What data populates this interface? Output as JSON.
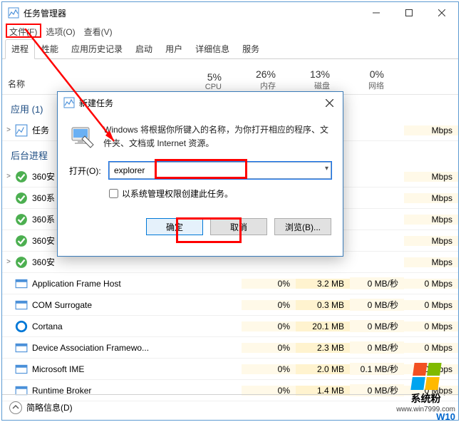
{
  "title": "任务管理器",
  "menus": {
    "file": "文件(F)",
    "options": "选项(O)",
    "view": "查看(V)"
  },
  "tabs": [
    "进程",
    "性能",
    "应用历史记录",
    "启动",
    "用户",
    "详细信息",
    "服务"
  ],
  "headers": {
    "name": "名称",
    "cpu": {
      "pct": "5%",
      "lbl": "CPU"
    },
    "mem": {
      "pct": "26%",
      "lbl": "内存"
    },
    "disk": {
      "pct": "13%",
      "lbl": "磁盘"
    },
    "net": {
      "pct": "0%",
      "lbl": "网络"
    }
  },
  "groups": {
    "apps": "应用 (1)",
    "bg": "后台进程"
  },
  "rows": [
    {
      "name": "任务",
      "cpu": "",
      "mem": "",
      "disk": "",
      "net": "Mbps",
      "exp": true,
      "icon": "tm"
    },
    {
      "name": "360安",
      "cpu": "",
      "mem": "",
      "disk": "",
      "net": "Mbps",
      "exp": true,
      "icon": "g1"
    },
    {
      "name": "360系",
      "cpu": "",
      "mem": "",
      "disk": "",
      "net": "Mbps",
      "exp": false,
      "icon": "g2"
    },
    {
      "name": "360系",
      "cpu": "",
      "mem": "",
      "disk": "",
      "net": "Mbps",
      "exp": false,
      "icon": "g3"
    },
    {
      "name": "360安",
      "cpu": "",
      "mem": "",
      "disk": "",
      "net": "Mbps",
      "exp": false,
      "icon": "g4"
    },
    {
      "name": "360安",
      "cpu": "",
      "mem": "",
      "disk": "",
      "net": "Mbps",
      "exp": true,
      "icon": "g5"
    },
    {
      "name": "Application Frame Host",
      "cpu": "0%",
      "mem": "3.2 MB",
      "disk": "0 MB/秒",
      "net": "0 Mbps",
      "icon": "w"
    },
    {
      "name": "COM Surrogate",
      "cpu": "0%",
      "mem": "0.3 MB",
      "disk": "0 MB/秒",
      "net": "0 Mbps",
      "icon": "w"
    },
    {
      "name": "Cortana",
      "cpu": "0%",
      "mem": "20.1 MB",
      "disk": "0 MB/秒",
      "net": "0 Mbps",
      "icon": "c"
    },
    {
      "name": "Device Association Framewo...",
      "cpu": "0%",
      "mem": "2.3 MB",
      "disk": "0 MB/秒",
      "net": "0 Mbps",
      "icon": "w"
    },
    {
      "name": "Microsoft IME",
      "cpu": "0%",
      "mem": "2.0 MB",
      "disk": "0.1 MB/秒",
      "net": "0 Mbps",
      "icon": "w"
    },
    {
      "name": "Runtime Broker",
      "cpu": "0%",
      "mem": "1.4 MB",
      "disk": "0 MB/秒",
      "net": "0 Mbps",
      "icon": "w"
    }
  ],
  "footer": "简略信息(D)",
  "dialog": {
    "title": "新建任务",
    "msg": "Windows 将根据你所键入的名称，为你打开相应的程序、文件夹、文档或 Internet 资源。",
    "open_lbl": "打开(O):",
    "input_value": "explorer",
    "admin_check": "以系统管理权限创建此任务。",
    "ok": "确定",
    "cancel": "取消",
    "browse": "浏览(B)..."
  },
  "brand": {
    "txt": "系统粉",
    "url": "www.win7999.com",
    "w": "W10"
  }
}
